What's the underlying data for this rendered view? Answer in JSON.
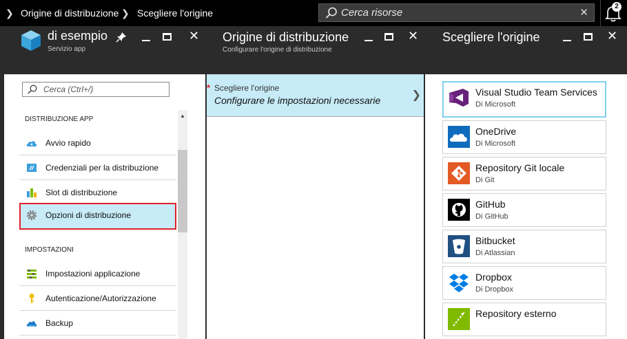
{
  "topbar": {
    "breadcrumb": [
      "Origine di distribuzione",
      "Scegliere l'origine"
    ],
    "search_placeholder": "Cerca risorse",
    "notification_count": "2"
  },
  "panel1": {
    "title": "di esempio",
    "subtitle": "Servizio app",
    "search_placeholder": "Cerca (Ctrl+/)",
    "sections": [
      {
        "label": "DISTRIBUZIONE APP",
        "items": [
          {
            "label": "Avvio rapido",
            "icon": "cloud-icon"
          },
          {
            "label": "Credenziali per la distribuzione",
            "icon": "credentials-icon"
          },
          {
            "label": "Slot di distribuzione",
            "icon": "slots-icon"
          },
          {
            "label": "Opzioni di distribuzione",
            "icon": "gear-icon",
            "selected": true
          }
        ]
      },
      {
        "label": "IMPOSTAZIONI",
        "items": [
          {
            "label": "Impostazioni applicazione",
            "icon": "settings-list-icon"
          },
          {
            "label": "Autenticazione/Autorizzazione",
            "icon": "key-icon"
          },
          {
            "label": "Backup",
            "icon": "backup-cloud-icon"
          }
        ]
      }
    ]
  },
  "panel2": {
    "title": "Origine di distribuzione",
    "subtitle": "Configurare l'origine di distribuzione",
    "row_label": "Scegliere l'origine",
    "row_value": "Configurare le impostazioni necessarie"
  },
  "panel3": {
    "title": "Scegliere l'origine",
    "sources": [
      {
        "name": "Visual Studio Team Services",
        "by": "Di Microsoft",
        "icon": "vsts-icon",
        "selected": true
      },
      {
        "name": "OneDrive",
        "by": "Di Microsoft",
        "icon": "onedrive-icon"
      },
      {
        "name": "Repository Git locale",
        "by": "Di Git",
        "icon": "git-icon"
      },
      {
        "name": "GitHub",
        "by": "Di GitHub",
        "icon": "github-icon"
      },
      {
        "name": "Bitbucket",
        "by": "Di Atlassian",
        "icon": "bitbucket-icon"
      },
      {
        "name": "Dropbox",
        "by": "Di Dropbox",
        "icon": "dropbox-icon"
      },
      {
        "name": "Repository esterno",
        "by": "",
        "icon": "external-repo-icon"
      }
    ]
  },
  "colors": {
    "selected_bg": "#c7ebf7",
    "highlight_border": "#e0202c",
    "header_bg": "#2b2b2b"
  }
}
